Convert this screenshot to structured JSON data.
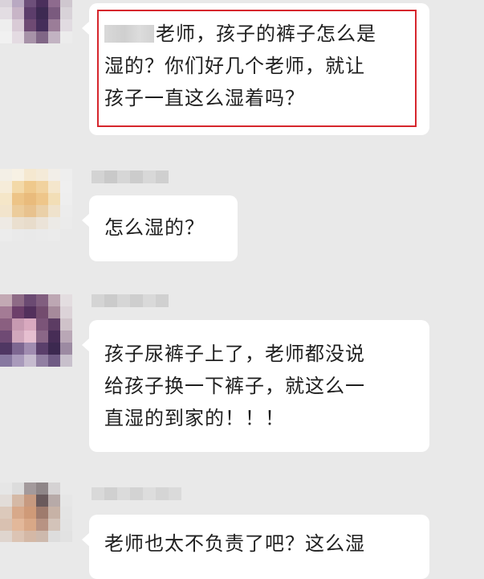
{
  "messages": [
    {
      "lines": [
        "老师，孩子的裤子怎么是",
        "湿的？你们好几个老师，就让",
        "孩子一直这么湿着吗？"
      ],
      "highlighted": true
    },
    {
      "lines": [
        "怎么湿的？"
      ]
    },
    {
      "lines": [
        "孩子尿裤子上了，老师都没说",
        "给孩子换一下裤子，就这么一",
        "直湿的到家的！！！"
      ]
    },
    {
      "lines": [
        "老师也太不负责了吧？这么湿"
      ]
    }
  ],
  "colors": {
    "background": "#e9e9e9",
    "bubble": "#ffffff",
    "highlight": "#d6262d",
    "text": "#1f1f1f"
  }
}
